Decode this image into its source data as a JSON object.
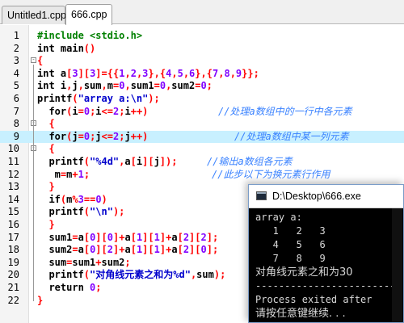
{
  "tabs": [
    {
      "label": "Untitled1.cpp",
      "active": false
    },
    {
      "label": "666.cpp",
      "active": true
    }
  ],
  "editor": {
    "highlight_line": 9,
    "lines": [
      {
        "n": "1",
        "parts": [
          {
            "t": "#include <stdio.h>",
            "c": "kw-pre"
          }
        ]
      },
      {
        "n": "2",
        "parts": [
          {
            "t": "int main()",
            "c": ""
          }
        ]
      },
      {
        "n": "3",
        "parts": [
          {
            "t": "{",
            "c": "brace"
          }
        ]
      },
      {
        "n": "4",
        "parts": [
          {
            "t": "int a[3][3]={{1,2,3},{4,5,6},{7,8,9}};",
            "c": "mixed4"
          }
        ]
      },
      {
        "n": "5",
        "parts": [
          {
            "t": "int i,j,sum,m=0,sum1=0,sum2=0;",
            "c": "mixed5"
          }
        ]
      },
      {
        "n": "6",
        "parts": [
          {
            "t": "printf(\"array a:\\n\");",
            "c": "mixed6"
          }
        ]
      },
      {
        "n": "7",
        "parts": [
          {
            "t": "  for(i=0;i<=2;i++)",
            "c": "mixed7"
          }
        ],
        "comment": "//处理a数组中的一行中各元素"
      },
      {
        "n": "8",
        "parts": [
          {
            "t": "  {",
            "c": "brace"
          }
        ]
      },
      {
        "n": "9",
        "parts": [
          {
            "t": "  for(j=0;j<=2;j++)",
            "c": "mixed7"
          }
        ],
        "comment": "//处理a数组中某一列元素"
      },
      {
        "n": "10",
        "parts": [
          {
            "t": "  {",
            "c": "brace"
          }
        ]
      },
      {
        "n": "11",
        "parts": [
          {
            "t": "  printf(\"%4d\",a[i][j]);",
            "c": "mixed11"
          }
        ],
        "comment": "//输出a数组各元素"
      },
      {
        "n": "12",
        "parts": [
          {
            "t": "   m=m+1;",
            "c": ""
          }
        ],
        "comment": "//此步以下为换元素行作用"
      },
      {
        "n": "13",
        "parts": [
          {
            "t": "  }",
            "c": "brace"
          }
        ]
      },
      {
        "n": "14",
        "parts": [
          {
            "t": "  if(m%3==0)",
            "c": "mixed14"
          }
        ]
      },
      {
        "n": "15",
        "parts": [
          {
            "t": "  printf(\"\\n\");",
            "c": "mixed15"
          }
        ]
      },
      {
        "n": "16",
        "parts": [
          {
            "t": "  }",
            "c": "brace"
          }
        ]
      },
      {
        "n": "17",
        "parts": [
          {
            "t": "  sum1=a[0][0]+a[1][1]+a[2][2];",
            "c": "mixed17"
          }
        ]
      },
      {
        "n": "18",
        "parts": [
          {
            "t": "  sum2=a[0][2]+a[1][1]+a[2][0];",
            "c": "mixed18"
          }
        ]
      },
      {
        "n": "19",
        "parts": [
          {
            "t": "  sum=sum1+sum2;",
            "c": ""
          }
        ]
      },
      {
        "n": "20",
        "parts": [
          {
            "t": "  printf(\"对角线元素之和为%d\",sum);",
            "c": "mixed20"
          }
        ]
      },
      {
        "n": "21",
        "parts": [
          {
            "t": "  return 0;",
            "c": "mixed21"
          }
        ]
      },
      {
        "n": "22",
        "parts": [
          {
            "t": "}",
            "c": "brace"
          }
        ]
      }
    ]
  },
  "console": {
    "title": "D:\\Desktop\\666.exe",
    "output": [
      "array a:",
      "   1   2   3",
      "   4   5   6",
      "   7   8   9",
      "对角线元素之和为30",
      "--------------------------------",
      "Process exited after",
      "请按任意键继续. . ."
    ]
  },
  "colors": {
    "preprocessor": "#008000",
    "string": "#0000cc",
    "number": "#8000ff",
    "brace": "#ff0000",
    "comment": "#3a82ff",
    "highlight": "#c8f0ff"
  }
}
